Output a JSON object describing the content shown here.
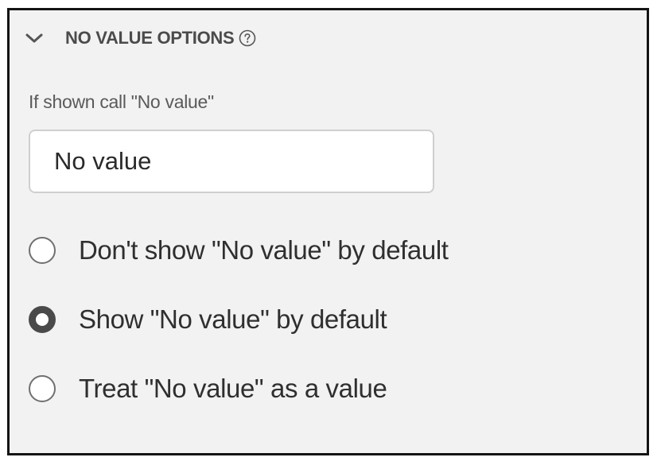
{
  "section": {
    "title": "NO VALUE OPTIONS",
    "expand_icon": "chevron-down-icon",
    "help_icon": "help-circle-icon"
  },
  "field": {
    "label": "If shown call \"No value\"",
    "value": "No value"
  },
  "options": [
    {
      "label": "Don't show \"No value\" by default",
      "checked": false
    },
    {
      "label": "Show \"No value\" by default",
      "checked": true
    },
    {
      "label": "Treat \"No value\" as a value",
      "checked": false
    }
  ],
  "colors": {
    "panel_background": "#f2f2f2",
    "border": "#141414",
    "text": "#2f2f2f"
  }
}
